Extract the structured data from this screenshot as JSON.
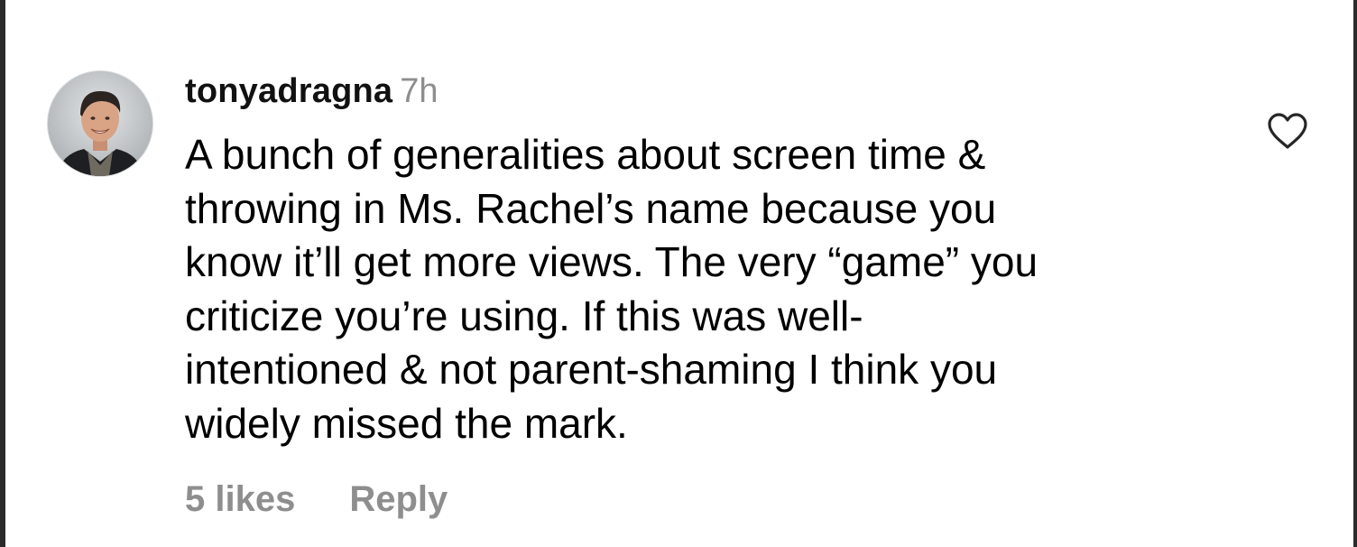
{
  "comment": {
    "username": "tonyadragna",
    "timestamp": "7h",
    "lines": [
      "A bunch of generalities about screen time &",
      "throwing in Ms. Rachel’s name because you",
      "know it’ll get more views. The very “game” you",
      "criticize you’re using. If this was well-",
      "intentioned & not parent-shaming I think you",
      "widely missed the mark."
    ],
    "likes_label": "5 likes",
    "reply_label": "Reply"
  },
  "icons": {
    "avatar": "user-avatar",
    "like": "heart-outline-icon"
  },
  "colors": {
    "text": "#000000",
    "muted": "#8e8e8e",
    "background": "#ffffff"
  }
}
